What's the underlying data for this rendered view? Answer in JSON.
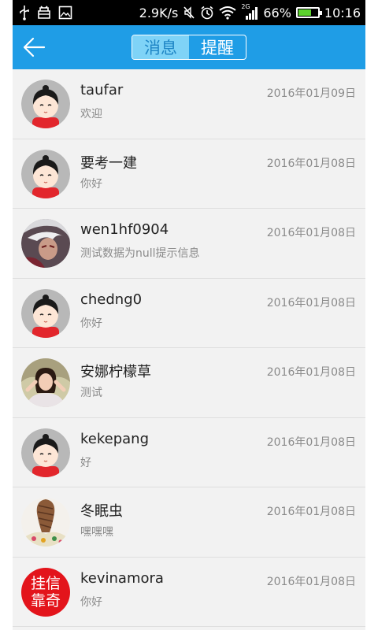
{
  "status_bar": {
    "speed": "2.9K/s",
    "network": "2G",
    "battery_percent": "66%",
    "battery_level": 0.66,
    "time": "10:16",
    "icons": [
      "usb-icon",
      "android-debug-icon",
      "image-icon",
      "mute-icon",
      "alarm-icon",
      "wifi-icon",
      "signal-icon",
      "battery-icon"
    ]
  },
  "header": {
    "back_icon": "back-arrow-icon",
    "tabs": [
      {
        "label": "消息",
        "active": true
      },
      {
        "label": "提醒",
        "active": false
      }
    ]
  },
  "colors": {
    "app_bar": "#1f9de6",
    "tab_active_bg": "#7fd3f7",
    "list_bg": "#f2f2f2"
  },
  "conversations": [
    {
      "name": "taufar",
      "message": "欢迎",
      "date": "2016年01月09日",
      "avatar": "cartoon-girl"
    },
    {
      "name": "要考一建",
      "message": "你好",
      "date": "2016年01月08日",
      "avatar": "cartoon-girl"
    },
    {
      "name": "wen1hf0904",
      "message": "测试数据为null提示信息",
      "date": "2016年01月08日",
      "avatar": "game-character"
    },
    {
      "name": "chedng0",
      "message": "你好",
      "date": "2016年01月08日",
      "avatar": "cartoon-girl"
    },
    {
      "name": "安娜柠檬草",
      "message": "测试",
      "date": "2016年01月08日",
      "avatar": "photo-girl"
    },
    {
      "name": "kekepang",
      "message": "好",
      "date": "2016年01月08日",
      "avatar": "cartoon-girl"
    },
    {
      "name": "冬眠虫",
      "message": "嘿嘿嘿",
      "date": "2016年01月08日",
      "avatar": "braid-photo"
    },
    {
      "name": "kevinamora",
      "message": "你好",
      "date": "2016年01月08日",
      "avatar": "red-seal",
      "avatar_text": "挂信靠奇"
    }
  ]
}
